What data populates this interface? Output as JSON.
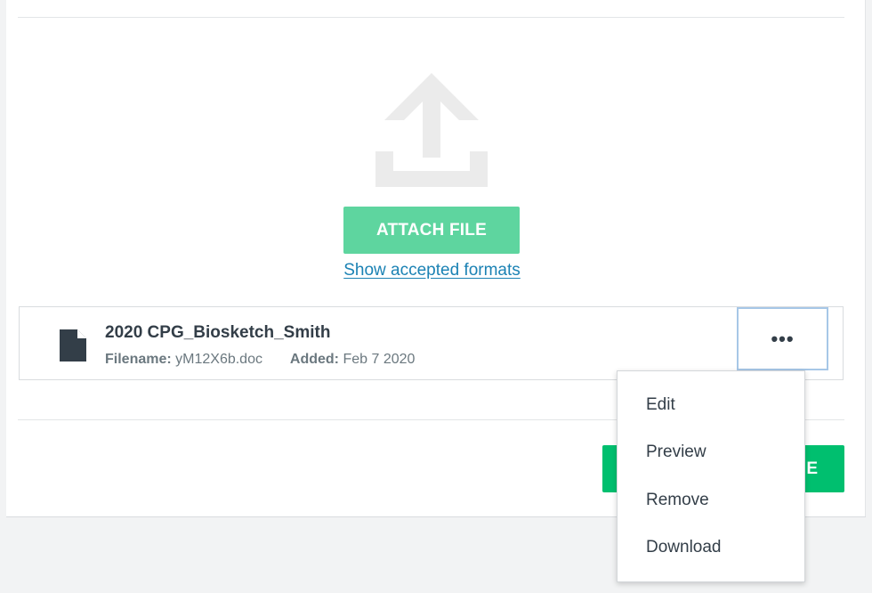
{
  "upload": {
    "icon": "upload-icon",
    "attach_label": "ATTACH FILE",
    "formats_link": "Show accepted formats"
  },
  "file": {
    "icon": "document-icon",
    "title": "2020 CPG_Biosketch_Smith",
    "filename_label": "Filename:",
    "filename_value": "yM12X6b.doc",
    "added_label": "Added:",
    "added_value": "Feb 7 2020",
    "more_label": "•••"
  },
  "footer": {
    "primary_button_label_visible": "E"
  },
  "menu": {
    "items": [
      {
        "label": "Edit"
      },
      {
        "label": "Preview"
      },
      {
        "label": "Remove"
      },
      {
        "label": "Download"
      }
    ]
  },
  "colors": {
    "attach_button": "#5ed59f",
    "primary_green": "#00bf6f",
    "link": "#1b82b4",
    "focus_ring": "#a7c7e7",
    "icon_gray": "#ebebeb"
  }
}
